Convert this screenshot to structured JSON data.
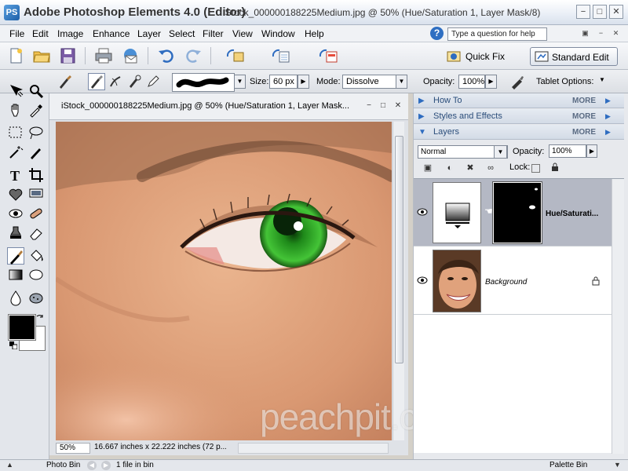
{
  "app": {
    "logo": "PS",
    "title": "Adobe Photoshop Elements 4.0 (Editor)",
    "document_title": "iStock_000000188225Medium.jpg @ 50% (Hue/Saturation 1, Layer Mask/8)",
    "minimize": "−",
    "maximize": "□",
    "close": "✕"
  },
  "menu": {
    "items": [
      "File",
      "Edit",
      "Image",
      "Enhance",
      "Layer",
      "Select",
      "Filter",
      "View",
      "Window",
      "Help"
    ],
    "help_glyph": "?",
    "help_placeholder": "Type a question for help",
    "mini_buttons": [
      "▣",
      "−",
      "✕"
    ]
  },
  "shortcuts": {
    "quick_fix": "Quick Fix",
    "standard_edit": "Standard Edit"
  },
  "options": {
    "size_label": "Size:",
    "size_value": "60 px",
    "mode_label": "Mode:",
    "mode_value": "Dissolve",
    "opacity_label": "Opacity:",
    "opacity_value": "100%",
    "tablet_label": "Tablet Options:",
    "dropdown_glyph": "▼",
    "step_glyph": "▶"
  },
  "document": {
    "title": "iStock_000000188225Medium.jpg @ 50% (Hue/Saturation 1, Layer Mask...",
    "zoom": "50%",
    "info": "16.667 inches x 22.222 inches (72 p...",
    "btn_min": "−",
    "btn_max": "□",
    "btn_close": "✕"
  },
  "watermark": "peachpit.com/video",
  "palettes": {
    "how_to": "How To",
    "styles": "Styles and Effects",
    "layers": "Layers",
    "more": "MORE",
    "collapsed_arrow": "▶",
    "expanded_arrow": "▼",
    "more_arrow": "▶"
  },
  "layers_panel": {
    "blend_mode": "Normal",
    "opacity_label": "Opacity:",
    "opacity_value": "100%",
    "lock_label": "Lock:",
    "tool_icons": [
      "▣",
      "◐",
      "✖",
      "∞"
    ],
    "layers": [
      {
        "name": "Hue/Saturati..."
      },
      {
        "name": "Background"
      }
    ]
  },
  "bottom_bar": {
    "photo_bin": "Photo Bin",
    "files": "1 file in bin",
    "palette_bin": "Palette Bin",
    "up_arrow": "▲",
    "down_arrow": "▼",
    "prev": "◀",
    "next": "▶"
  },
  "colors": {
    "foreground": "#000000",
    "background": "#ffffff",
    "accent": "#2e6cc0",
    "iris": "#3cba2f"
  }
}
